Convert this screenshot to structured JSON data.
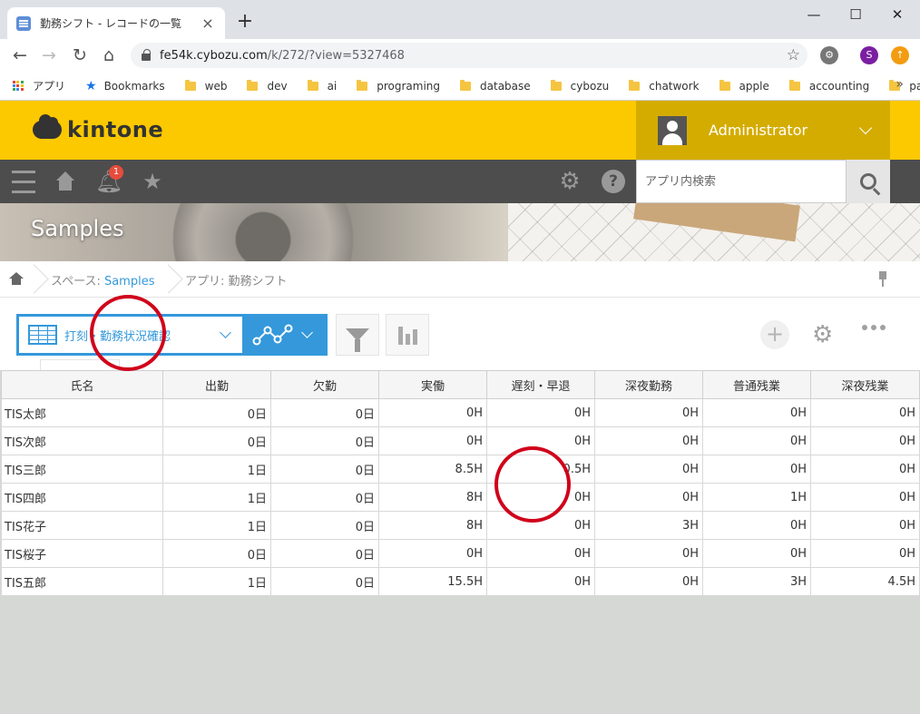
{
  "browser": {
    "tab_title": "勤務シフト - レコードの一覧",
    "tab_close": "×",
    "new_tab": "+",
    "url_host": "fe54k.cybozu.com",
    "url_path": "/k/272/?view=5327468",
    "profile_initial": "S",
    "bookmarks": [
      "アプリ",
      "Bookmarks",
      "web",
      "dev",
      "ai",
      "programing",
      "database",
      "cybozu",
      "chatwork",
      "apple",
      "accounting",
      "pay"
    ],
    "more": "»"
  },
  "kintone": {
    "logo": "kintone",
    "user_name": "Administrator",
    "notification_count": "1",
    "search_placeholder": "アプリ内検索",
    "space_title": "Samples",
    "breadcrumb": {
      "space_prefix": "スペース: ",
      "space_name": "Samples",
      "app": "アプリ: 勤務シフト"
    },
    "view_name": "打刻・勤務状況確認",
    "add_label": "+"
  },
  "table": {
    "headers": [
      "氏名",
      "出勤",
      "欠勤",
      "実働",
      "遅刻・早退",
      "深夜勤務",
      "普通残業",
      "深夜残業"
    ],
    "rows": [
      [
        "TIS太郎",
        "0日",
        "0日",
        "0H",
        "0H",
        "0H",
        "0H",
        "0H"
      ],
      [
        "TIS次郎",
        "0日",
        "0日",
        "0H",
        "0H",
        "0H",
        "0H",
        "0H"
      ],
      [
        "TIS三郎",
        "1日",
        "0日",
        "8.5H",
        "0.5H",
        "0H",
        "0H",
        "0H"
      ],
      [
        "TIS四郎",
        "1日",
        "0日",
        "8H",
        "0H",
        "0H",
        "1H",
        "0H"
      ],
      [
        "TIS花子",
        "1日",
        "0日",
        "8H",
        "0H",
        "3H",
        "0H",
        "0H"
      ],
      [
        "TIS桜子",
        "0日",
        "0日",
        "0H",
        "0H",
        "0H",
        "0H",
        "0H"
      ],
      [
        "TIS五郎",
        "1日",
        "0日",
        "15.5H",
        "0H",
        "0H",
        "3H",
        "4.5H"
      ]
    ]
  },
  "colors": {
    "kintone_yellow": "#fcc800",
    "nav_dark": "#4d4d4d",
    "view_blue": "#3498db",
    "annotation_red": "#d0021b"
  }
}
